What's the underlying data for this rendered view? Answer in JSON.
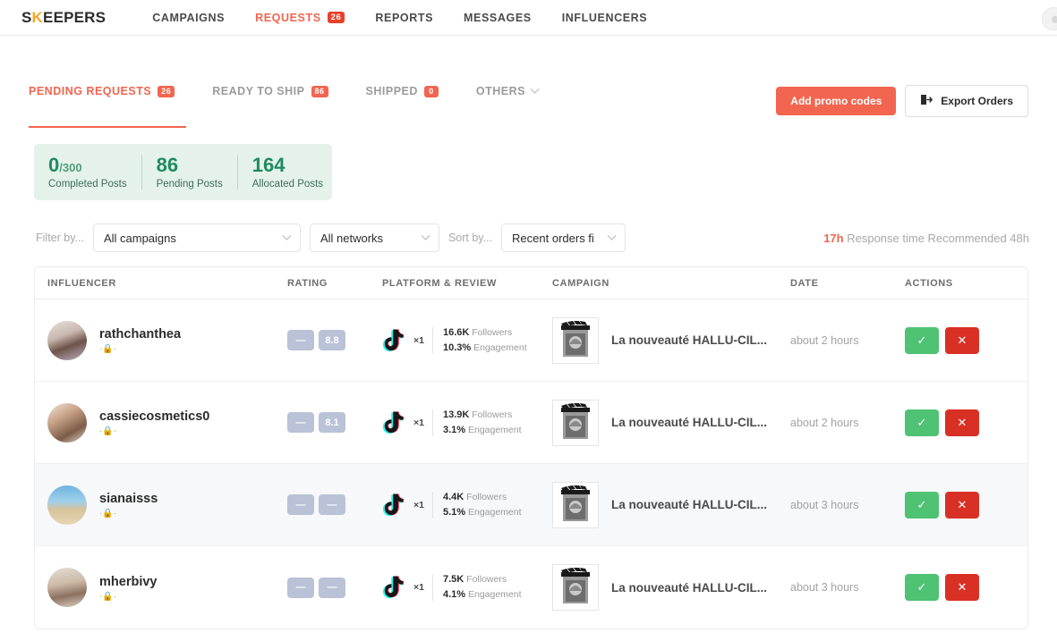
{
  "topnav": {
    "logo_pre": "S",
    "logo_k": "K",
    "logo_post": "EEPERS",
    "links": [
      {
        "label": "CAMPAIGNS",
        "badge": null
      },
      {
        "label": "REQUESTS",
        "badge": "26"
      },
      {
        "label": "REPORTS",
        "badge": null
      },
      {
        "label": "MESSAGES",
        "badge": null
      },
      {
        "label": "INFLUENCERS",
        "badge": null
      }
    ]
  },
  "tabs": [
    {
      "label": "PENDING REQUESTS",
      "badge": "26",
      "active": true
    },
    {
      "label": "READY TO SHIP",
      "badge": "86",
      "active": false
    },
    {
      "label": "SHIPPED",
      "badge": "0",
      "active": false
    },
    {
      "label": "OTHERS",
      "badge": null,
      "active": false
    }
  ],
  "actions": {
    "add_promo_label": "Add promo codes",
    "export_label": "Export Orders"
  },
  "stats": [
    {
      "value": "0",
      "suffix": "/300",
      "label": "Completed Posts"
    },
    {
      "value": "86",
      "suffix": "",
      "label": "Pending Posts"
    },
    {
      "value": "164",
      "suffix": "",
      "label": "Allocated Posts"
    }
  ],
  "filters": {
    "filter_by_label": "Filter by...",
    "campaigns_value": "All campaigns",
    "networks_value": "All networks",
    "sort_by_label": "Sort by...",
    "sort_value": "Recent orders fi",
    "response_time_value": "17h",
    "response_time_text": " Response time Recommended 48h"
  },
  "table": {
    "headers": {
      "influencer": "INFLUENCER",
      "rating": "RATING",
      "platform": "PLATFORM & REVIEW",
      "campaign": "CAMPAIGN",
      "date": "DATE",
      "actions": "ACTIONS"
    },
    "rows": [
      {
        "name": "rathchanthea",
        "sub": "·🔒·",
        "rating_left": "—",
        "rating_right": "8.8",
        "network": "tiktok",
        "multiplier": "×1",
        "followers": "16.6K",
        "followers_label": "Followers",
        "engagement": "10.3%",
        "engagement_label": "Engagement",
        "campaign": "La nouveauté HALLU-CIL...",
        "date": "about 2 hours",
        "accept": "✓",
        "reject": "✕"
      },
      {
        "name": "cassiecosmetics0",
        "sub": "·🔒·",
        "rating_left": "—",
        "rating_right": "8.1",
        "network": "tiktok",
        "multiplier": "×1",
        "followers": "13.9K",
        "followers_label": "Followers",
        "engagement": "3.1%",
        "engagement_label": "Engagement",
        "campaign": "La nouveauté HALLU-CIL...",
        "date": "about 2 hours",
        "accept": "✓",
        "reject": "✕"
      },
      {
        "name": "sianaisss",
        "sub": "·🔒·",
        "rating_left": "—",
        "rating_right": "—",
        "network": "tiktok",
        "multiplier": "×1",
        "followers": "4.4K",
        "followers_label": "Followers",
        "engagement": "5.1%",
        "engagement_label": "Engagement",
        "campaign": "La nouveauté HALLU-CIL...",
        "date": "about 3 hours",
        "accept": "✓",
        "reject": "✕"
      },
      {
        "name": "mherbivy",
        "sub": "·🔒·",
        "rating_left": "—",
        "rating_right": "—",
        "network": "tiktok",
        "multiplier": "×1",
        "followers": "7.5K",
        "followers_label": "Followers",
        "engagement": "4.1%",
        "engagement_label": "Engagement",
        "campaign": "La nouveauté HALLU-CIL...",
        "date": "about 3 hours",
        "accept": "✓",
        "reject": "✕"
      }
    ]
  },
  "colors": {
    "accent": "#f2654f",
    "badge_red": "#e8412c",
    "green": "#1f8b5f",
    "accept": "#4fc274",
    "reject": "#d93025",
    "rating_badge": "#b9c2d6"
  }
}
